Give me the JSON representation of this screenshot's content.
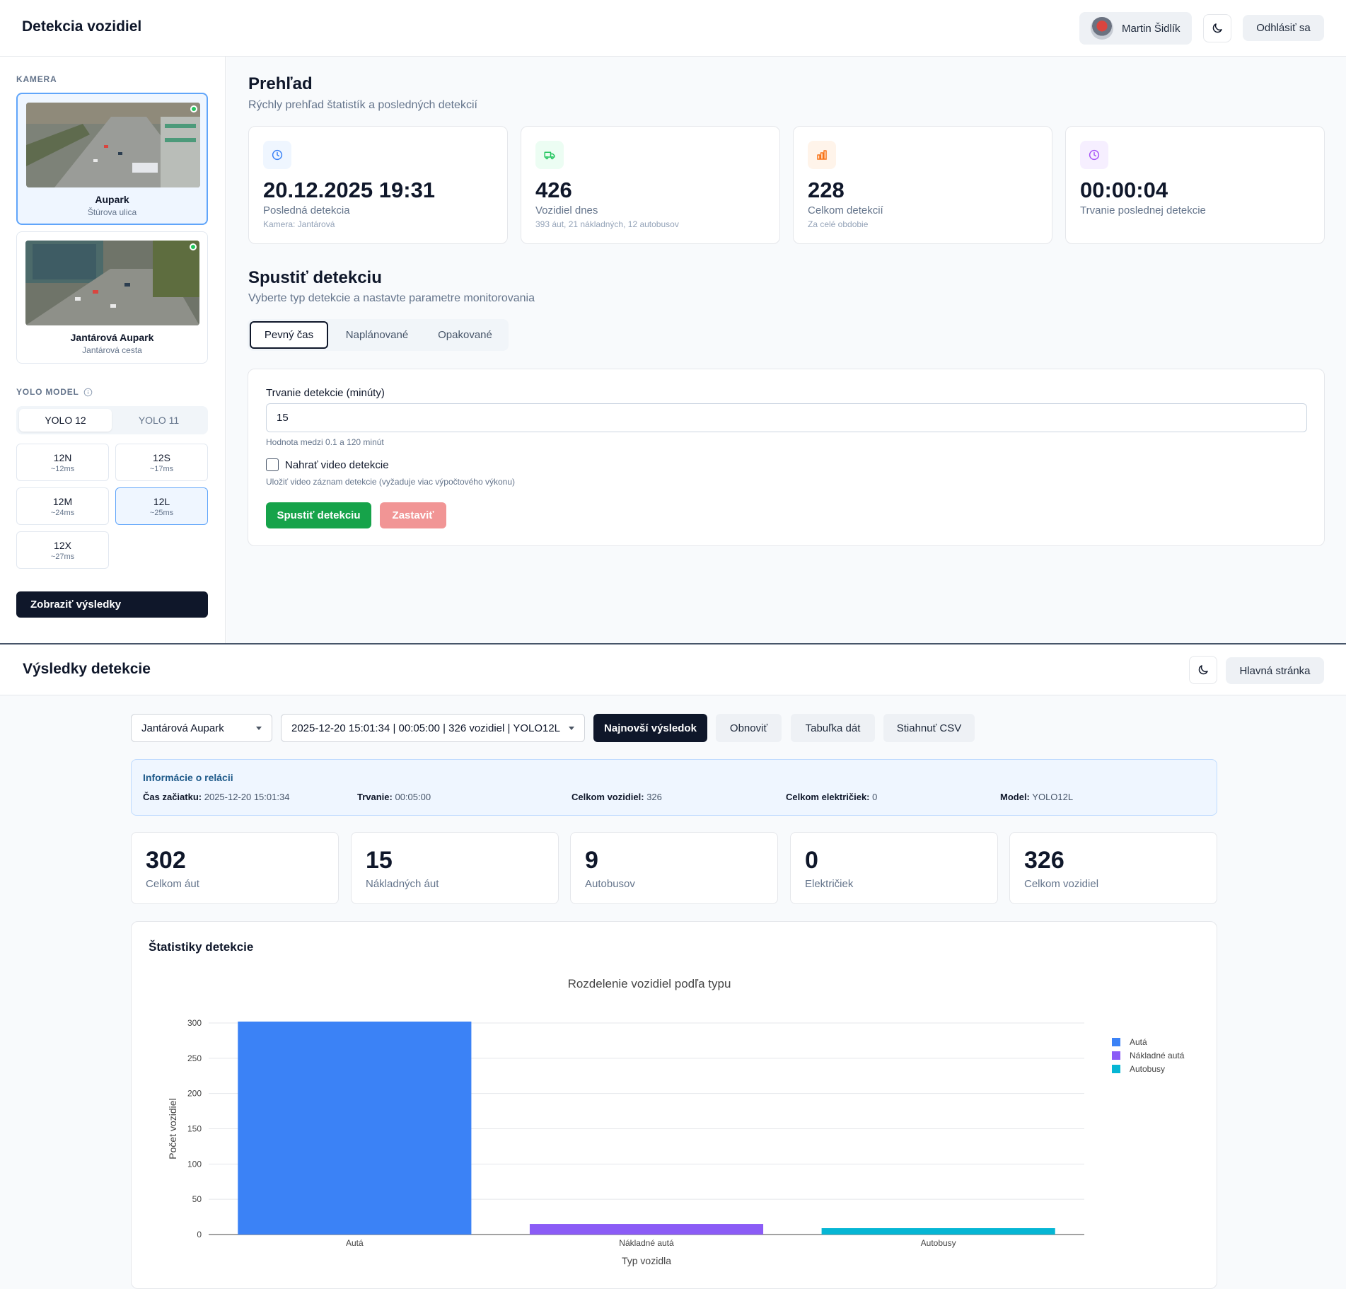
{
  "detection_app": {
    "title": "Detekcia vozidiel",
    "user_name": "Martin Šidlík",
    "theme_icon": "moon-icon",
    "logout_label": "Odhlásiť sa",
    "sidebar": {
      "camera_section": "KAMERA",
      "cameras": [
        {
          "name": "Aupark",
          "location": "Štúrova ulica",
          "active": true
        },
        {
          "name": "Jantárová Aupark",
          "location": "Jantárová cesta",
          "active": false
        }
      ],
      "yolo_section": "YOLO MODEL",
      "yolo_versions": [
        "YOLO 12",
        "YOLO 11"
      ],
      "selected_version": "YOLO 12",
      "models": [
        {
          "name": "12N",
          "speed": "~12ms"
        },
        {
          "name": "12S",
          "speed": "~17ms"
        },
        {
          "name": "12M",
          "speed": "~24ms"
        },
        {
          "name": "12L",
          "speed": "~25ms"
        },
        {
          "name": "12X",
          "speed": "~27ms"
        }
      ],
      "selected_model": "12L",
      "results_button": "Zobraziť výsledky"
    },
    "overview": {
      "title": "Prehľad",
      "subtitle": "Rýchly prehľad štatistík a posledných detekcií",
      "cards": [
        {
          "icon": "clock-icon",
          "value": "20.12.2025 19:31",
          "label": "Posledná detekcia",
          "note": "Kamera: Jantárová",
          "color": "#3b82f6"
        },
        {
          "icon": "truck-icon",
          "value": "426",
          "label": "Vozidiel dnes",
          "note": "393 áut, 21 nákladných, 12 autobusov",
          "color": "#22c55e"
        },
        {
          "icon": "bar-chart-icon",
          "value": "228",
          "label": "Celkom detekcií",
          "note": "Za celé obdobie",
          "color": "#f97316"
        },
        {
          "icon": "clock-icon",
          "value": "00:00:04",
          "label": "Trvanie poslednej detekcie",
          "note": "",
          "color": "#a855f7"
        }
      ]
    },
    "run": {
      "title": "Spustiť detekciu",
      "subtitle": "Vyberte typ detekcie a nastavte parametre monitorovania",
      "tabs": [
        "Pevný čas",
        "Naplánované",
        "Opakované"
      ],
      "selected_tab": "Pevný čas",
      "duration_label": "Trvanie detekcie (minúty)",
      "duration_value": "15",
      "duration_help": "Hodnota medzi 0.1 a 120 minút",
      "record_label": "Nahrať video detekcie",
      "record_help": "Uložiť video záznam detekcie (vyžaduje viac výpočtového výkonu)",
      "start_button": "Spustiť detekciu",
      "stop_button": "Zastaviť"
    }
  },
  "results_app": {
    "title": "Výsledky detekcie",
    "home_button": "Hlavná stránka",
    "camera_select": "Jantárová Aupark",
    "session_select": "2025-12-20 15:01:34 | 00:05:00 | 326 vozidiel | YOLO12L",
    "buttons": {
      "latest": "Najnovší výsledok",
      "refresh": "Obnoviť",
      "table": "Tabuľka dát",
      "csv": "Stiahnuť CSV"
    },
    "session_info": {
      "title": "Informácie o relácii",
      "items": [
        {
          "label": "Čas začiatku:",
          "value": "2025-12-20 15:01:34"
        },
        {
          "label": "Trvanie:",
          "value": "00:05:00"
        },
        {
          "label": "Celkom vozidiel:",
          "value": "326"
        },
        {
          "label": "Celkom električiek:",
          "value": "0"
        },
        {
          "label": "Model:",
          "value": "YOLO12L"
        }
      ]
    },
    "kpis": [
      {
        "value": "302",
        "label": "Celkom áut"
      },
      {
        "value": "15",
        "label": "Nákladných áut"
      },
      {
        "value": "9",
        "label": "Autobusov"
      },
      {
        "value": "0",
        "label": "Električiek"
      },
      {
        "value": "326",
        "label": "Celkom vozidiel"
      }
    ],
    "stats_title": "Štatistiky detekcie"
  },
  "chart_data": {
    "type": "bar",
    "title": "Rozdelenie vozidiel podľa typu",
    "xlabel": "Typ vozidla",
    "ylabel": "Počet vozidiel",
    "categories": [
      "Autá",
      "Nákladné autá",
      "Autobusy"
    ],
    "values": [
      302,
      15,
      9
    ],
    "colors": [
      "#3b82f6",
      "#8b5cf6",
      "#06b6d4"
    ],
    "legend": [
      "Autá",
      "Nákladné autá",
      "Autobusy"
    ],
    "legend_position": "top-right",
    "ylim": [
      0,
      300
    ],
    "yticks": [
      0,
      50,
      100,
      150,
      200,
      250,
      300
    ],
    "grid": true
  }
}
